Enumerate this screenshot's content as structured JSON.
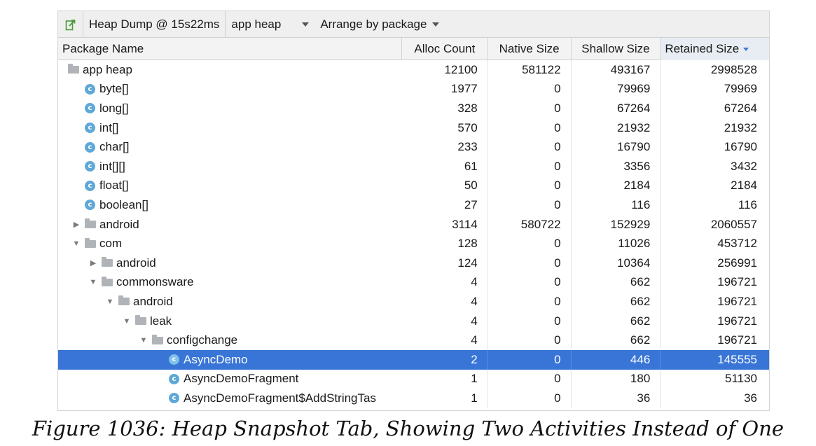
{
  "toolbar": {
    "export_icon": "export-icon",
    "title": "Heap Dump @ 15s22ms",
    "heap": "app heap",
    "arrange": "Arrange by package"
  },
  "columns": [
    "Package Name",
    "Alloc Count",
    "Native Size",
    "Shallow Size",
    "Retained Size"
  ],
  "sorted_column": "Retained Size",
  "rows": [
    {
      "name": "app heap",
      "kind": "folder",
      "level": 0,
      "expander": "",
      "alloc": "12100",
      "native": "581122",
      "shallow": "493167",
      "retained": "2998528"
    },
    {
      "name": "byte[]",
      "kind": "class",
      "level": 1,
      "expander": "",
      "alloc": "1977",
      "native": "0",
      "shallow": "79969",
      "retained": "79969"
    },
    {
      "name": "long[]",
      "kind": "class",
      "level": 1,
      "expander": "",
      "alloc": "328",
      "native": "0",
      "shallow": "67264",
      "retained": "67264"
    },
    {
      "name": "int[]",
      "kind": "class",
      "level": 1,
      "expander": "",
      "alloc": "570",
      "native": "0",
      "shallow": "21932",
      "retained": "21932"
    },
    {
      "name": "char[]",
      "kind": "class",
      "level": 1,
      "expander": "",
      "alloc": "233",
      "native": "0",
      "shallow": "16790",
      "retained": "16790"
    },
    {
      "name": "int[][]",
      "kind": "class",
      "level": 1,
      "expander": "",
      "alloc": "61",
      "native": "0",
      "shallow": "3356",
      "retained": "3432"
    },
    {
      "name": "float[]",
      "kind": "class",
      "level": 1,
      "expander": "",
      "alloc": "50",
      "native": "0",
      "shallow": "2184",
      "retained": "2184"
    },
    {
      "name": "boolean[]",
      "kind": "class",
      "level": 1,
      "expander": "",
      "alloc": "27",
      "native": "0",
      "shallow": "116",
      "retained": "116"
    },
    {
      "name": "android",
      "kind": "folder",
      "level": 0,
      "expander": "collapsed",
      "alloc": "3114",
      "native": "580722",
      "shallow": "152929",
      "retained": "2060557"
    },
    {
      "name": "com",
      "kind": "folder",
      "level": 0,
      "expander": "expanded",
      "alloc": "128",
      "native": "0",
      "shallow": "11026",
      "retained": "453712"
    },
    {
      "name": "android",
      "kind": "folder",
      "level": 1,
      "expander": "collapsed",
      "alloc": "124",
      "native": "0",
      "shallow": "10364",
      "retained": "256991"
    },
    {
      "name": "commonsware",
      "kind": "folder",
      "level": 1,
      "expander": "expanded",
      "alloc": "4",
      "native": "0",
      "shallow": "662",
      "retained": "196721"
    },
    {
      "name": "android",
      "kind": "folder",
      "level": 2,
      "expander": "expanded",
      "alloc": "4",
      "native": "0",
      "shallow": "662",
      "retained": "196721"
    },
    {
      "name": "leak",
      "kind": "folder",
      "level": 3,
      "expander": "expanded",
      "alloc": "4",
      "native": "0",
      "shallow": "662",
      "retained": "196721"
    },
    {
      "name": "configchange",
      "kind": "folder",
      "level": 4,
      "expander": "expanded",
      "alloc": "4",
      "native": "0",
      "shallow": "662",
      "retained": "196721"
    },
    {
      "name": "AsyncDemo",
      "kind": "class",
      "level": 6,
      "expander": "",
      "alloc": "2",
      "native": "0",
      "shallow": "446",
      "retained": "145555",
      "selected": true
    },
    {
      "name": "AsyncDemoFragment",
      "kind": "class",
      "level": 6,
      "expander": "",
      "alloc": "1",
      "native": "0",
      "shallow": "180",
      "retained": "51130"
    },
    {
      "name": "AsyncDemoFragment$AddStringTas",
      "kind": "class",
      "level": 6,
      "expander": "",
      "alloc": "1",
      "native": "0",
      "shallow": "36",
      "retained": "36"
    }
  ],
  "caption": "Figure 1036: Heap Snapshot Tab, Showing Two Activities Instead of One"
}
